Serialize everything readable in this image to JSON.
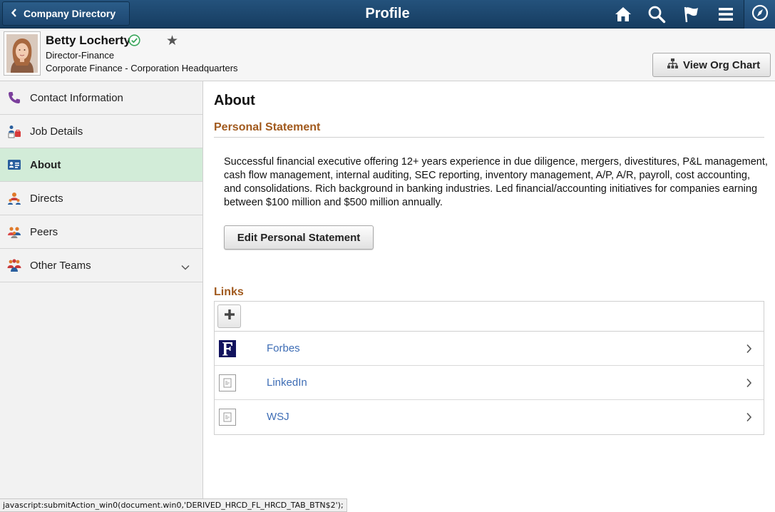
{
  "banner": {
    "back_label": "Company Directory",
    "title": "Profile",
    "icons": [
      "home-icon",
      "search-icon",
      "flag-icon",
      "menu-icon",
      "navbar-icon"
    ]
  },
  "employee": {
    "name": "Betty Locherty",
    "title": "Director-Finance",
    "department": "Corporate Finance - Corporation Headquarters",
    "org_chart_label": "View Org Chart"
  },
  "sidebar": {
    "items": [
      {
        "label": "Contact Information",
        "icon": "phone-icon"
      },
      {
        "label": "Job Details",
        "icon": "job-details-icon"
      },
      {
        "label": "About",
        "icon": "about-card-icon",
        "active": true
      },
      {
        "label": "Directs",
        "icon": "directs-icon"
      },
      {
        "label": "Peers",
        "icon": "peers-icon"
      },
      {
        "label": "Other Teams",
        "icon": "teams-icon"
      }
    ]
  },
  "content": {
    "heading": "About",
    "personal_statement_label": "Personal Statement",
    "statement_text": "Successful financial executive offering 12+ years experience in due diligence, mergers, divestitures, P&L management, cash flow management, internal auditing, SEC reporting, inventory management, A/P, A/R, payroll, cost accounting, and consolidations.  Rich background in banking  industries.  Led financial/accounting initiatives for companies earning between $100 million and $500 million annually.",
    "edit_button_label": "Edit Personal Statement",
    "links_label": "Links",
    "links": [
      {
        "label": "Forbes",
        "icon": "forbes-logo-icon"
      },
      {
        "label": "LinkedIn",
        "icon": "broken-image-icon"
      },
      {
        "label": "WSJ",
        "icon": "broken-image-icon"
      }
    ]
  },
  "status_bar": "javascript:submitAction_win0(document.win0,'DERIVED_HRCD_FL_HRCD_TAB_BTN$2');",
  "colors": {
    "banner": "#1d4670",
    "active_tab": "#d2ecd8",
    "section_heading": "#a15a1e",
    "link": "#3e6db5"
  }
}
